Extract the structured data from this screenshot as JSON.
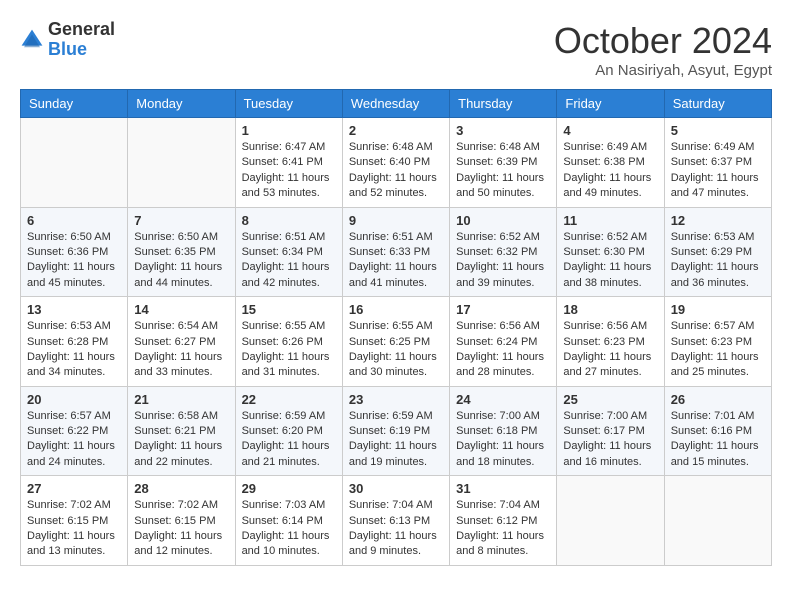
{
  "header": {
    "logo": {
      "general": "General",
      "blue": "Blue"
    },
    "title": "October 2024",
    "location": "An Nasiriyah, Asyut, Egypt"
  },
  "weekdays": [
    "Sunday",
    "Monday",
    "Tuesday",
    "Wednesday",
    "Thursday",
    "Friday",
    "Saturday"
  ],
  "weeks": [
    [
      {
        "day": "",
        "sunrise": "",
        "sunset": "",
        "daylight": ""
      },
      {
        "day": "",
        "sunrise": "",
        "sunset": "",
        "daylight": ""
      },
      {
        "day": "1",
        "sunrise": "Sunrise: 6:47 AM",
        "sunset": "Sunset: 6:41 PM",
        "daylight": "Daylight: 11 hours and 53 minutes."
      },
      {
        "day": "2",
        "sunrise": "Sunrise: 6:48 AM",
        "sunset": "Sunset: 6:40 PM",
        "daylight": "Daylight: 11 hours and 52 minutes."
      },
      {
        "day": "3",
        "sunrise": "Sunrise: 6:48 AM",
        "sunset": "Sunset: 6:39 PM",
        "daylight": "Daylight: 11 hours and 50 minutes."
      },
      {
        "day": "4",
        "sunrise": "Sunrise: 6:49 AM",
        "sunset": "Sunset: 6:38 PM",
        "daylight": "Daylight: 11 hours and 49 minutes."
      },
      {
        "day": "5",
        "sunrise": "Sunrise: 6:49 AM",
        "sunset": "Sunset: 6:37 PM",
        "daylight": "Daylight: 11 hours and 47 minutes."
      }
    ],
    [
      {
        "day": "6",
        "sunrise": "Sunrise: 6:50 AM",
        "sunset": "Sunset: 6:36 PM",
        "daylight": "Daylight: 11 hours and 45 minutes."
      },
      {
        "day": "7",
        "sunrise": "Sunrise: 6:50 AM",
        "sunset": "Sunset: 6:35 PM",
        "daylight": "Daylight: 11 hours and 44 minutes."
      },
      {
        "day": "8",
        "sunrise": "Sunrise: 6:51 AM",
        "sunset": "Sunset: 6:34 PM",
        "daylight": "Daylight: 11 hours and 42 minutes."
      },
      {
        "day": "9",
        "sunrise": "Sunrise: 6:51 AM",
        "sunset": "Sunset: 6:33 PM",
        "daylight": "Daylight: 11 hours and 41 minutes."
      },
      {
        "day": "10",
        "sunrise": "Sunrise: 6:52 AM",
        "sunset": "Sunset: 6:32 PM",
        "daylight": "Daylight: 11 hours and 39 minutes."
      },
      {
        "day": "11",
        "sunrise": "Sunrise: 6:52 AM",
        "sunset": "Sunset: 6:30 PM",
        "daylight": "Daylight: 11 hours and 38 minutes."
      },
      {
        "day": "12",
        "sunrise": "Sunrise: 6:53 AM",
        "sunset": "Sunset: 6:29 PM",
        "daylight": "Daylight: 11 hours and 36 minutes."
      }
    ],
    [
      {
        "day": "13",
        "sunrise": "Sunrise: 6:53 AM",
        "sunset": "Sunset: 6:28 PM",
        "daylight": "Daylight: 11 hours and 34 minutes."
      },
      {
        "day": "14",
        "sunrise": "Sunrise: 6:54 AM",
        "sunset": "Sunset: 6:27 PM",
        "daylight": "Daylight: 11 hours and 33 minutes."
      },
      {
        "day": "15",
        "sunrise": "Sunrise: 6:55 AM",
        "sunset": "Sunset: 6:26 PM",
        "daylight": "Daylight: 11 hours and 31 minutes."
      },
      {
        "day": "16",
        "sunrise": "Sunrise: 6:55 AM",
        "sunset": "Sunset: 6:25 PM",
        "daylight": "Daylight: 11 hours and 30 minutes."
      },
      {
        "day": "17",
        "sunrise": "Sunrise: 6:56 AM",
        "sunset": "Sunset: 6:24 PM",
        "daylight": "Daylight: 11 hours and 28 minutes."
      },
      {
        "day": "18",
        "sunrise": "Sunrise: 6:56 AM",
        "sunset": "Sunset: 6:23 PM",
        "daylight": "Daylight: 11 hours and 27 minutes."
      },
      {
        "day": "19",
        "sunrise": "Sunrise: 6:57 AM",
        "sunset": "Sunset: 6:23 PM",
        "daylight": "Daylight: 11 hours and 25 minutes."
      }
    ],
    [
      {
        "day": "20",
        "sunrise": "Sunrise: 6:57 AM",
        "sunset": "Sunset: 6:22 PM",
        "daylight": "Daylight: 11 hours and 24 minutes."
      },
      {
        "day": "21",
        "sunrise": "Sunrise: 6:58 AM",
        "sunset": "Sunset: 6:21 PM",
        "daylight": "Daylight: 11 hours and 22 minutes."
      },
      {
        "day": "22",
        "sunrise": "Sunrise: 6:59 AM",
        "sunset": "Sunset: 6:20 PM",
        "daylight": "Daylight: 11 hours and 21 minutes."
      },
      {
        "day": "23",
        "sunrise": "Sunrise: 6:59 AM",
        "sunset": "Sunset: 6:19 PM",
        "daylight": "Daylight: 11 hours and 19 minutes."
      },
      {
        "day": "24",
        "sunrise": "Sunrise: 7:00 AM",
        "sunset": "Sunset: 6:18 PM",
        "daylight": "Daylight: 11 hours and 18 minutes."
      },
      {
        "day": "25",
        "sunrise": "Sunrise: 7:00 AM",
        "sunset": "Sunset: 6:17 PM",
        "daylight": "Daylight: 11 hours and 16 minutes."
      },
      {
        "day": "26",
        "sunrise": "Sunrise: 7:01 AM",
        "sunset": "Sunset: 6:16 PM",
        "daylight": "Daylight: 11 hours and 15 minutes."
      }
    ],
    [
      {
        "day": "27",
        "sunrise": "Sunrise: 7:02 AM",
        "sunset": "Sunset: 6:15 PM",
        "daylight": "Daylight: 11 hours and 13 minutes."
      },
      {
        "day": "28",
        "sunrise": "Sunrise: 7:02 AM",
        "sunset": "Sunset: 6:15 PM",
        "daylight": "Daylight: 11 hours and 12 minutes."
      },
      {
        "day": "29",
        "sunrise": "Sunrise: 7:03 AM",
        "sunset": "Sunset: 6:14 PM",
        "daylight": "Daylight: 11 hours and 10 minutes."
      },
      {
        "day": "30",
        "sunrise": "Sunrise: 7:04 AM",
        "sunset": "Sunset: 6:13 PM",
        "daylight": "Daylight: 11 hours and 9 minutes."
      },
      {
        "day": "31",
        "sunrise": "Sunrise: 7:04 AM",
        "sunset": "Sunset: 6:12 PM",
        "daylight": "Daylight: 11 hours and 8 minutes."
      },
      {
        "day": "",
        "sunrise": "",
        "sunset": "",
        "daylight": ""
      },
      {
        "day": "",
        "sunrise": "",
        "sunset": "",
        "daylight": ""
      }
    ]
  ]
}
